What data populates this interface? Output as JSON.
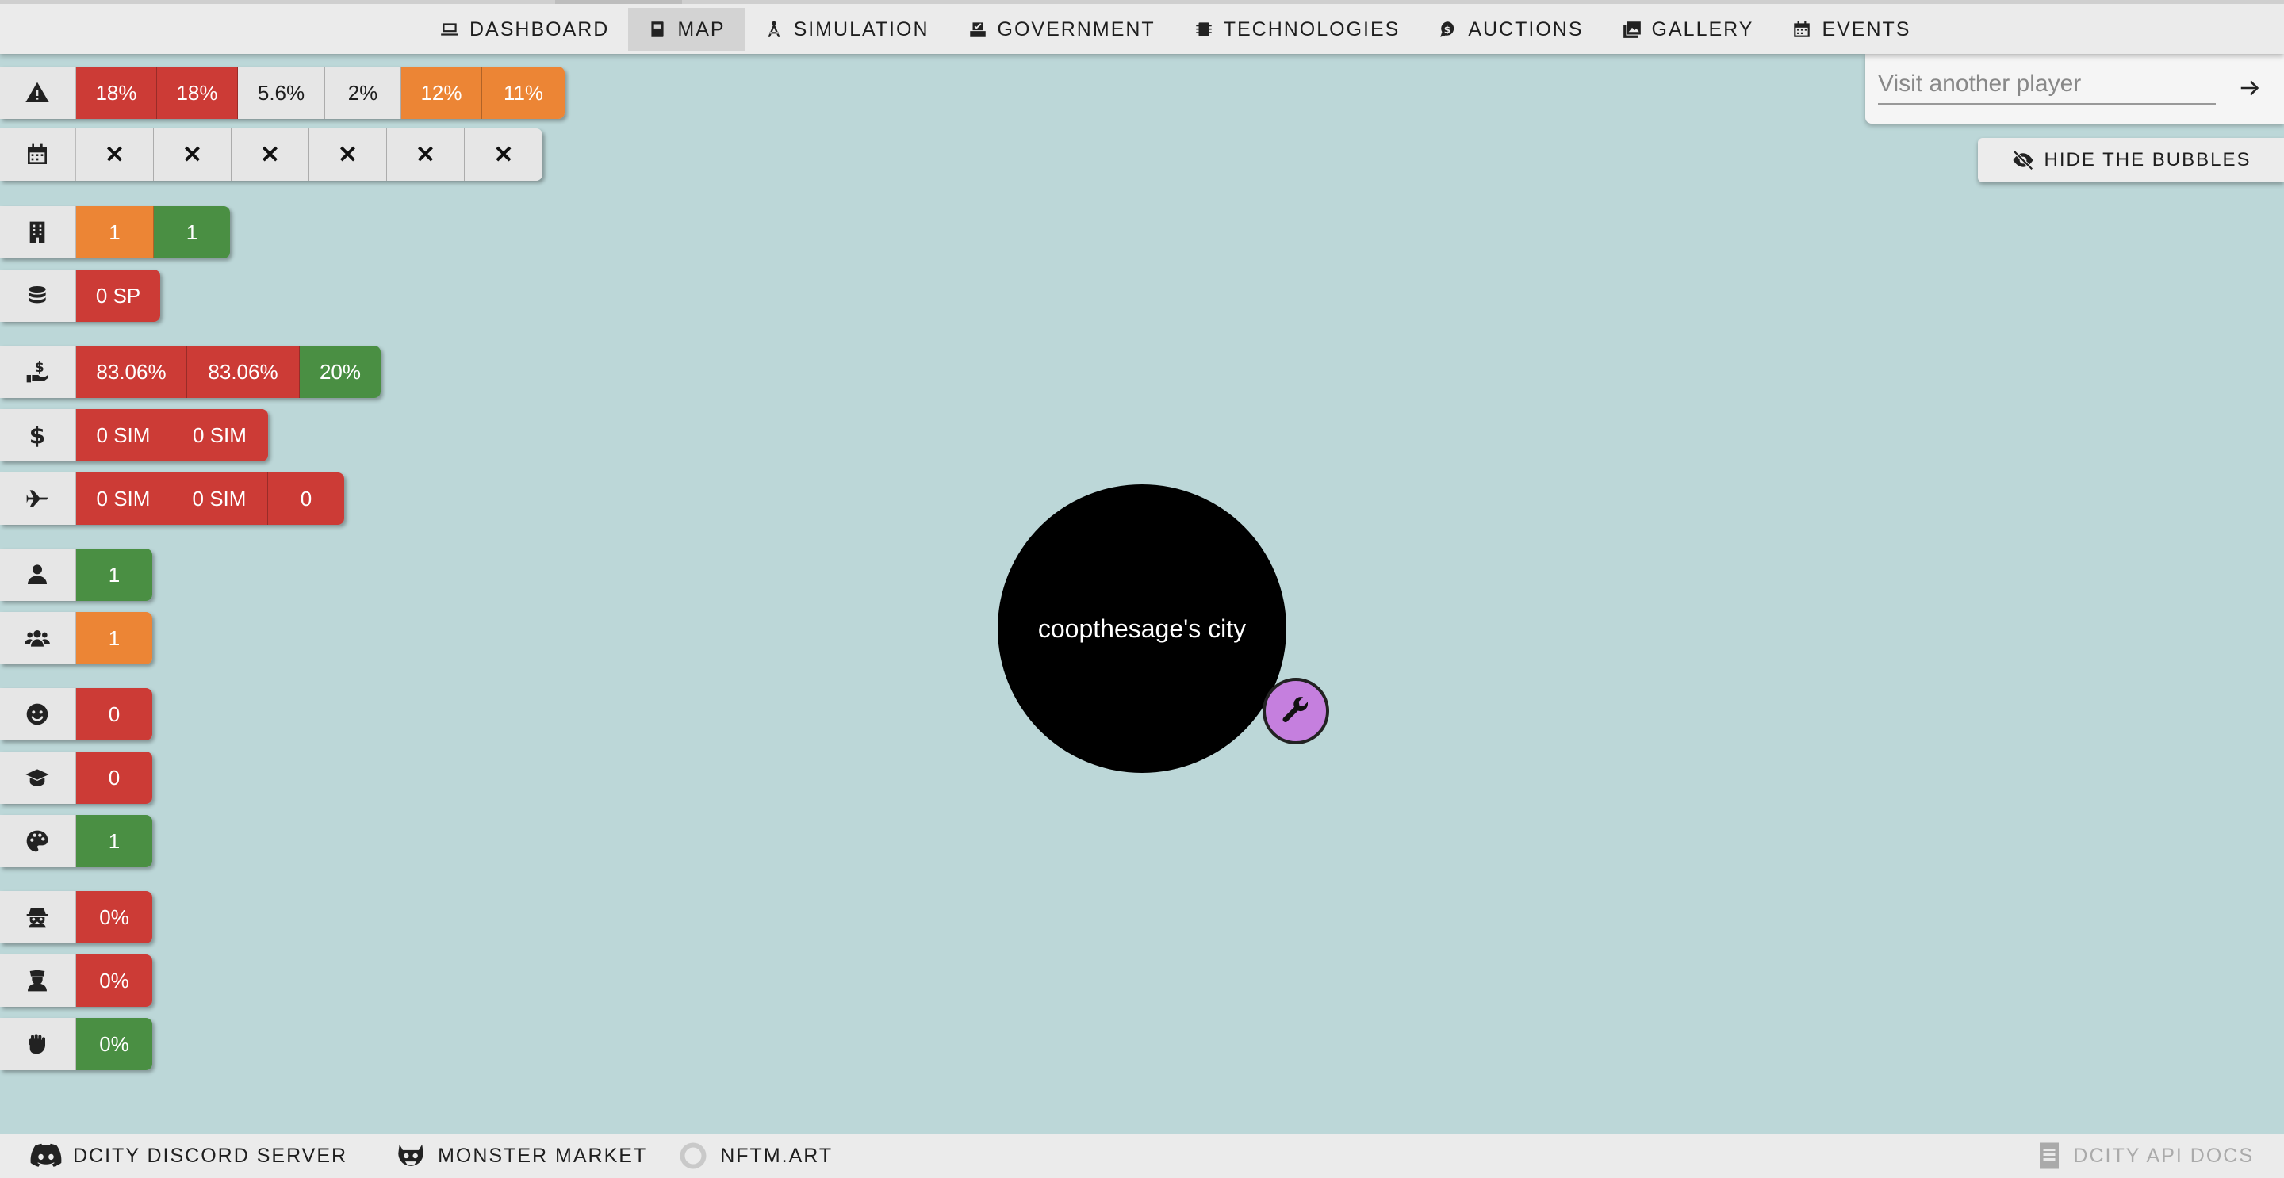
{
  "nav": {
    "items": [
      {
        "label": "DASHBOARD",
        "icon": "laptop-icon",
        "active": false
      },
      {
        "label": "MAP",
        "icon": "book-icon",
        "active": true
      },
      {
        "label": "SIMULATION",
        "icon": "compass-icon",
        "active": false
      },
      {
        "label": "GOVERNMENT",
        "icon": "ballot-icon",
        "active": false
      },
      {
        "label": "TECHNOLOGIES",
        "icon": "chip-icon",
        "active": false
      },
      {
        "label": "AUCTIONS",
        "icon": "bid-icon",
        "active": false
      },
      {
        "label": "GALLERY",
        "icon": "images-icon",
        "active": false
      },
      {
        "label": "EVENTS",
        "icon": "calendar-icon",
        "active": false
      }
    ]
  },
  "stats": {
    "risk": {
      "icon": "warning-icon",
      "cells": [
        "18%",
        "18%",
        "5.6%",
        "2%",
        "12%",
        "11%"
      ]
    },
    "calendar": {
      "icon": "calendar-icon",
      "cells": [
        "✕",
        "✕",
        "✕",
        "✕",
        "✕",
        "✕"
      ]
    },
    "buildings": {
      "icon": "building-icon",
      "cells": [
        "1",
        "1"
      ]
    },
    "coins": {
      "icon": "coins-icon",
      "cells": [
        "0 SP"
      ]
    },
    "income": {
      "icon": "hand-dollar-icon",
      "cells": [
        "83.06%",
        "83.06%",
        "20%"
      ]
    },
    "money": {
      "icon": "dollar-icon",
      "cells": [
        "0 SIM",
        "0 SIM"
      ]
    },
    "flights": {
      "icon": "plane-icon",
      "cells": [
        "0 SIM",
        "0 SIM",
        "0"
      ]
    },
    "person": {
      "icon": "person-icon",
      "cells": [
        "1"
      ]
    },
    "population": {
      "icon": "group-icon",
      "cells": [
        "1"
      ]
    },
    "happiness": {
      "icon": "smile-icon",
      "cells": [
        "0"
      ]
    },
    "education": {
      "icon": "graduation-cap-icon",
      "cells": [
        "0"
      ]
    },
    "art": {
      "icon": "palette-icon",
      "cells": [
        "1"
      ]
    },
    "crime": {
      "icon": "spy-icon",
      "cells": [
        "0%"
      ]
    },
    "police": {
      "icon": "officer-icon",
      "cells": [
        "0%"
      ]
    },
    "protest": {
      "icon": "fist-icon",
      "cells": [
        "0%"
      ]
    }
  },
  "colors": {
    "red": "#cc3b36",
    "orange": "#ec8535",
    "green": "#4a8f43",
    "map_bg": "#bcd7d8",
    "wrench": "#c57fde"
  },
  "visit": {
    "placeholder": "Visit another player"
  },
  "hide_bubbles": {
    "label": "HIDE THE BUBBLES"
  },
  "city": {
    "name": "coopthesage's city"
  },
  "footer": {
    "discord": "DCITY DISCORD SERVER",
    "monster": "MONSTER MARKET",
    "nftm": "NFTM.ART",
    "docs": "DCITY API DOCS"
  }
}
